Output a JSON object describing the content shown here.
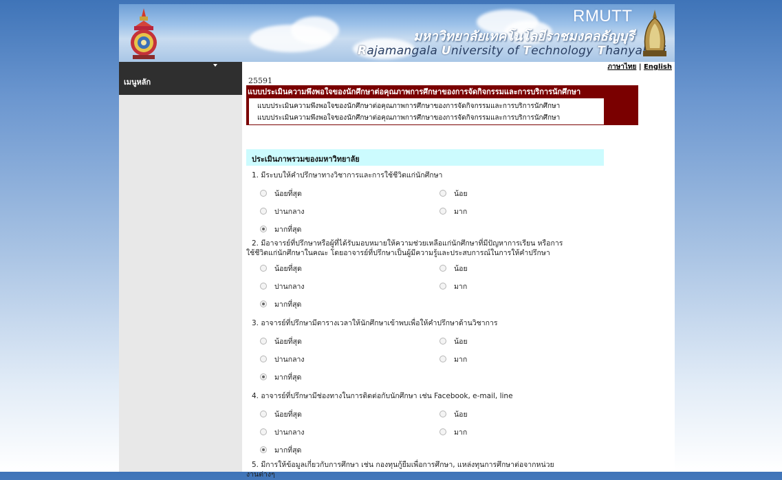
{
  "header": {
    "short_name": "RMUTT",
    "thai_name": "มหาวิทยาลัยเทคโนโลยีราชมงคลธัญบุรี",
    "english_name": {
      "R": "R",
      "p1": "ajamangala ",
      "U": "U",
      "p2": "niversity  of  ",
      "T": "T",
      "p3": "echnology  ",
      "T2": "T",
      "p4": "hanyaburi"
    },
    "lang_thai": "ภาษาไทย",
    "lang_sep": "|",
    "lang_english": "English"
  },
  "sidebar": {
    "title": "เมนูหลัก"
  },
  "form": {
    "code": "25591",
    "category_title": "แบบประเมินความพึงพอใจของนักศึกษาต่อคุณภาพการศึกษาของการจัดกิจกรรมและการบริการนักศึกษา",
    "category_lines": [
      "แบบประเมินความพึงพอใจของนักศึกษาต่อคุณภาพการศึกษาของการจัดกิจกรรมและการบริการนักศึกษา",
      "แบบประเมินความพึงพอใจของนักศึกษาต่อคุณภาพการศึกษาของการจัดกิจกรรมและการบริการนักศึกษา"
    ],
    "section_title": "ประเมินภาพรวมของมหาวิทยาลัย",
    "options": [
      "น้อยที่สุด",
      "น้อย",
      "ปานกลาง",
      "มาก",
      "มากที่สุด"
    ],
    "questions": [
      {
        "text": "1.  มีระบบให้คำปรึกษาทางวิชาการและการใช้ชีวิตแก่นักศึกษา",
        "selected": "มากที่สุด"
      },
      {
        "text": "2.  มีอาจารย์ที่ปรึกษาหรือผู้ที่ได้รับมอบหมายให้ความช่วยเหลือแก่นักศึกษาที่มีปัญหาการเรียน หรือการ",
        "text2": "ใช้ชีวิตแก่นักศึกษาในคณะ โดยอาจารย์ที่ปรึกษาเป็นผู้มีความรู้และประสบการณ์ในการให้คำปรึกษา",
        "selected": "มากที่สุด"
      },
      {
        "text": "3.  อาจารย์ที่ปรึกษามีตารางเวลาให้นักศึกษาเข้าพบเพื่อให้คำปรึกษาด้านวิชาการ",
        "selected": "มากที่สุด"
      },
      {
        "text": "4.  อาจารย์ที่ปรึกษามีช่องทางในการติดต่อกับนักศึกษา เช่น Facebook, e-mail, line",
        "selected": "มากที่สุด"
      },
      {
        "text": "5.  มีการให้ข้อมูลเกี่ยวกับการศึกษา เช่น กองทุนกู้ยืมเพื่อการศึกษา, แหล่งทุนการศึกษาต่อจากหน่วย",
        "text2": "งานต่างๆ"
      }
    ]
  }
}
